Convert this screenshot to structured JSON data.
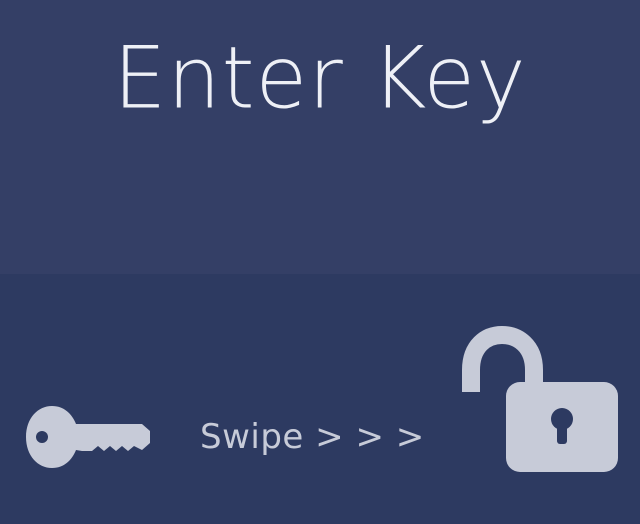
{
  "title": "Enter Key",
  "swipe_hint": "Swipe > > >",
  "icons": {
    "key": "key-icon",
    "lock": "unlocked-padlock-icon"
  },
  "colors": {
    "top_background": "#343f66",
    "bottom_background": "#2d3a61",
    "title_text": "#eef0f6",
    "icon_fill": "#c7cbd8"
  }
}
